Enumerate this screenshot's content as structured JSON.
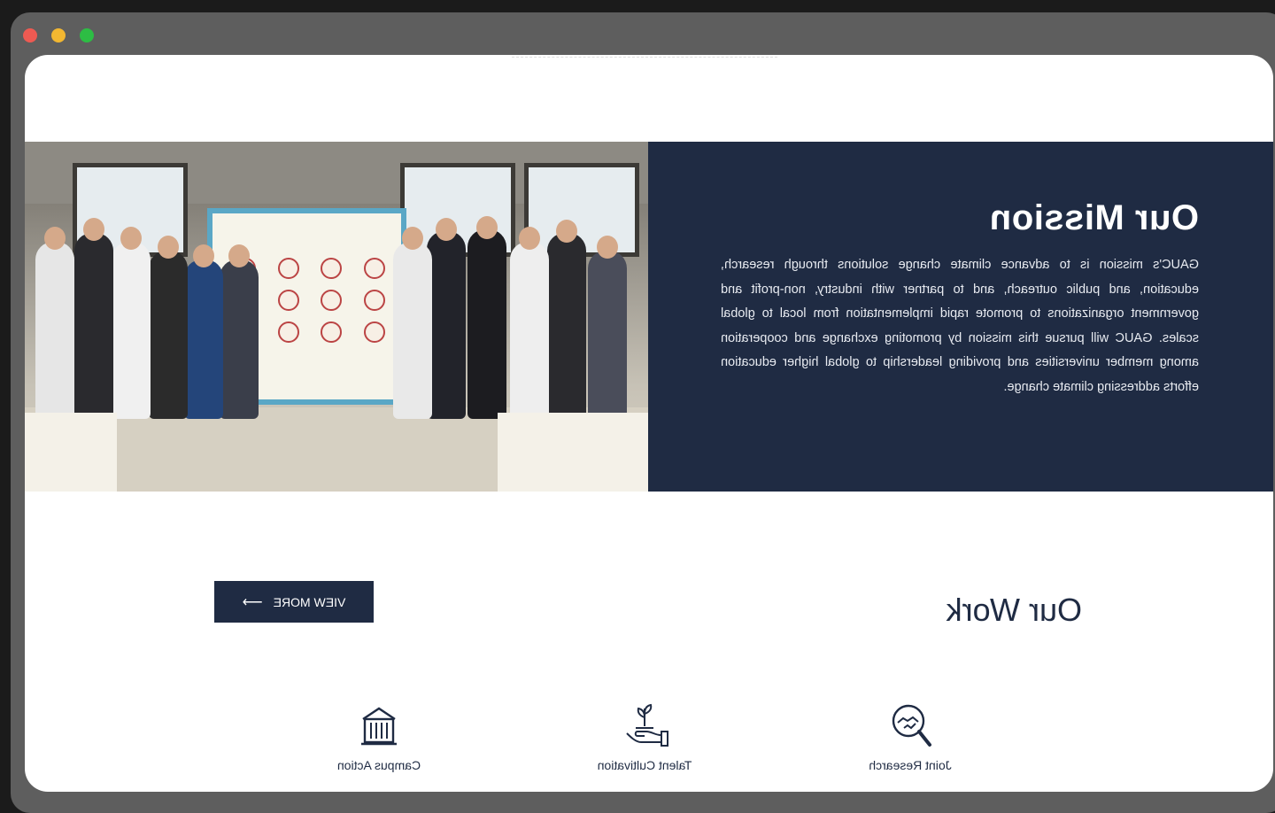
{
  "window": {
    "buttons": [
      "close",
      "minimize",
      "maximize"
    ]
  },
  "mission": {
    "title": "Our Mission",
    "body": "GAUC's mission is to advance climate change solutions through research, education, and public outreach, and to partner with industry, non-profit and government organizations to promote rapid implementation from local to global scales. GAUC will pursue this mission by promoting exchange and cooperation among member universities and providing leadership to global higher education efforts addressing climate change.",
    "photo_alt": "Group photo of university representatives in front of a signing board"
  },
  "work": {
    "title": "Our Work",
    "view_more_label": "VIEW MORE",
    "items": [
      {
        "label": "Joint Research",
        "icon": "handshake-magnifier-icon"
      },
      {
        "label": "Talent Cultivation",
        "icon": "hand-sprout-icon"
      },
      {
        "label": "Campus Action",
        "icon": "campus-building-icon"
      }
    ]
  },
  "colors": {
    "navy": "#1f2b43",
    "white": "#ffffff",
    "frame": "#5e5e5e"
  }
}
